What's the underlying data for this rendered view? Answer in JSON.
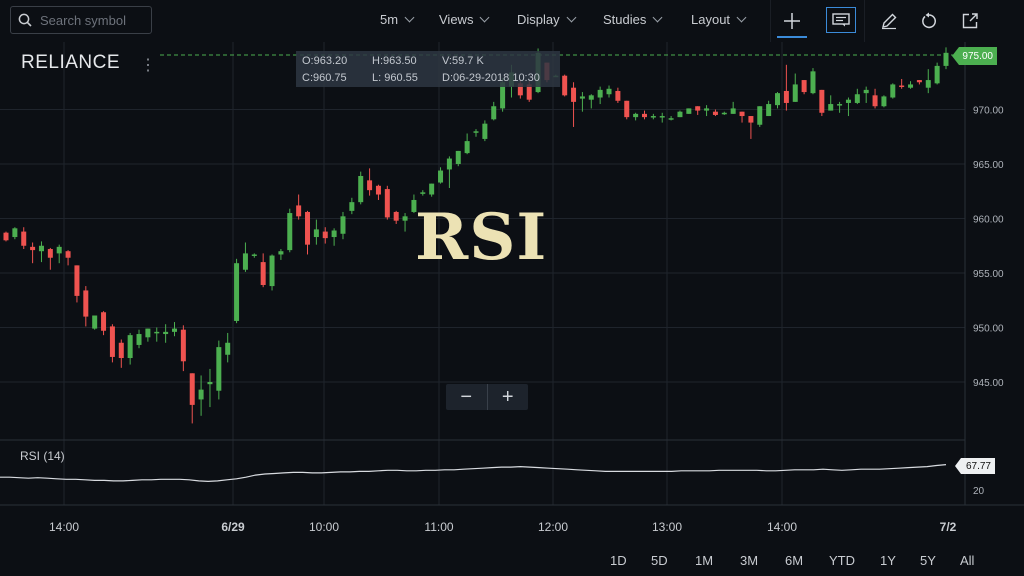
{
  "toolbar": {
    "search_placeholder": "Search symbol",
    "interval": "5m",
    "views": "Views",
    "display": "Display",
    "studies": "Studies",
    "layout": "Layout",
    "icons": [
      "search-icon",
      "crosshair-icon",
      "comment-icon",
      "pencil-icon",
      "undo-icon",
      "share-icon"
    ]
  },
  "symbol": "RELIANCE",
  "ohlc": {
    "open": "O:963.20",
    "high": "H:963.50",
    "volume": "V:59.7 K",
    "close": "C:960.75",
    "low": "L: 960.55",
    "date": "D:06-29-2018 10:30"
  },
  "overlay_text": "RSI",
  "zoom": {
    "minus": "−",
    "plus": "+"
  },
  "rsi": {
    "label": "RSI (14)",
    "value": "67.77",
    "tick": "20"
  },
  "range_buttons": [
    "1D",
    "5D",
    "1M",
    "3M",
    "6M",
    "YTD",
    "1Y",
    "5Y",
    "All"
  ],
  "colors": {
    "up": "#4caf50",
    "down": "#ef5350",
    "background": "#0c0f14",
    "grid": "#1f242c",
    "accent": "#3b8bd9"
  },
  "chart_data": {
    "type": "candlestick",
    "ylim": [
      940,
      976
    ],
    "price_ticks": [
      "975.00",
      "970.00",
      "965.00",
      "960.00",
      "955.00",
      "950.00",
      "945.00"
    ],
    "price_tick_values": [
      975,
      970,
      965,
      960,
      955,
      950,
      945
    ],
    "last_price": "975.00",
    "time_ticks": [
      {
        "label": "14:00",
        "bold": false
      },
      {
        "label": "6/29",
        "bold": true
      },
      {
        "label": "10:00",
        "bold": false
      },
      {
        "label": "11:00",
        "bold": false
      },
      {
        "label": "12:00",
        "bold": false
      },
      {
        "label": "13:00",
        "bold": false
      },
      {
        "label": "14:00",
        "bold": false
      },
      {
        "label": "7/2",
        "bold": true
      }
    ],
    "candles": [
      [
        958.7,
        958.8,
        957.9,
        958.0
      ],
      [
        958.3,
        959.2,
        958.1,
        959.1
      ],
      [
        958.8,
        959.2,
        957.2,
        957.5
      ],
      [
        957.4,
        957.8,
        955.9,
        957.1
      ],
      [
        957.0,
        957.9,
        956.0,
        957.5
      ],
      [
        957.2,
        957.3,
        955.3,
        956.4
      ],
      [
        956.8,
        957.6,
        955.9,
        957.4
      ],
      [
        957.0,
        957.1,
        955.7,
        956.4
      ],
      [
        955.7,
        955.7,
        952.3,
        952.9
      ],
      [
        953.4,
        953.8,
        950.1,
        951.0
      ],
      [
        949.9,
        951.1,
        949.8,
        951.1
      ],
      [
        951.4,
        951.5,
        949.3,
        949.7
      ],
      [
        950.1,
        950.3,
        946.8,
        947.3
      ],
      [
        948.6,
        948.9,
        946.3,
        947.2
      ],
      [
        947.2,
        949.5,
        946.6,
        949.3
      ],
      [
        948.4,
        949.8,
        948.1,
        949.4
      ],
      [
        949.1,
        949.9,
        948.7,
        949.9
      ],
      [
        949.5,
        950.0,
        948.7,
        949.6
      ],
      [
        949.4,
        950.3,
        948.6,
        949.6
      ],
      [
        949.6,
        950.5,
        949.2,
        949.9
      ],
      [
        949.8,
        950.2,
        946.0,
        946.9
      ],
      [
        945.8,
        945.8,
        941.2,
        942.9
      ],
      [
        943.4,
        945.6,
        941.9,
        944.3
      ],
      [
        944.8,
        946.2,
        942.7,
        945.0
      ],
      [
        944.2,
        948.8,
        943.4,
        948.2
      ],
      [
        947.5,
        949.5,
        946.8,
        948.6
      ],
      [
        950.6,
        956.3,
        950.4,
        955.9
      ],
      [
        955.3,
        957.8,
        955.1,
        956.8
      ],
      [
        956.6,
        956.8,
        956.4,
        956.7
      ],
      [
        956.0,
        956.8,
        953.7,
        953.9
      ],
      [
        953.8,
        956.7,
        953.4,
        956.6
      ],
      [
        956.7,
        957.2,
        956.2,
        957.0
      ],
      [
        957.1,
        960.9,
        956.9,
        960.5
      ],
      [
        961.2,
        962.2,
        959.9,
        960.2
      ],
      [
        960.6,
        960.7,
        956.7,
        957.6
      ],
      [
        958.3,
        959.9,
        957.6,
        959.0
      ],
      [
        958.8,
        959.2,
        957.7,
        958.2
      ],
      [
        958.3,
        959.1,
        957.5,
        958.9
      ],
      [
        958.6,
        960.6,
        958.1,
        960.2
      ],
      [
        960.7,
        961.9,
        960.4,
        961.5
      ],
      [
        961.5,
        964.3,
        961.3,
        963.9
      ],
      [
        963.5,
        964.6,
        962.1,
        962.6
      ],
      [
        963.0,
        963.1,
        961.7,
        962.2
      ],
      [
        962.7,
        963.0,
        959.9,
        960.1
      ],
      [
        960.6,
        960.7,
        959.5,
        959.8
      ],
      [
        959.8,
        960.5,
        958.8,
        960.2
      ],
      [
        960.6,
        962.2,
        960.5,
        961.7
      ],
      [
        962.3,
        962.6,
        962.1,
        962.4
      ],
      [
        962.2,
        963.2,
        962.0,
        963.2
      ],
      [
        963.3,
        964.7,
        963.2,
        964.4
      ],
      [
        964.5,
        965.7,
        962.8,
        965.5
      ],
      [
        965.0,
        966.2,
        964.8,
        966.2
      ],
      [
        966.0,
        967.8,
        965.9,
        967.1
      ],
      [
        967.9,
        968.2,
        967.5,
        968.0
      ],
      [
        967.3,
        969.0,
        967.1,
        968.7
      ],
      [
        969.1,
        970.7,
        969.0,
        970.3
      ],
      [
        970.1,
        972.9,
        969.8,
        972.5
      ],
      [
        972.1,
        974.1,
        971.1,
        973.4
      ],
      [
        972.4,
        972.7,
        971.0,
        971.3
      ],
      [
        972.3,
        972.6,
        970.7,
        970.9
      ],
      [
        971.6,
        975.6,
        971.5,
        975.2
      ],
      [
        974.3,
        974.3,
        972.5,
        972.7
      ],
      [
        973.0,
        973.2,
        973.0,
        973.1
      ],
      [
        973.1,
        973.2,
        971.2,
        971.3
      ],
      [
        972.0,
        972.5,
        968.4,
        970.7
      ],
      [
        971.0,
        971.6,
        969.8,
        971.2
      ],
      [
        970.9,
        971.4,
        970.1,
        971.3
      ],
      [
        971.1,
        972.1,
        970.5,
        971.8
      ],
      [
        971.4,
        972.2,
        971.1,
        971.9
      ],
      [
        971.7,
        972.0,
        970.6,
        970.8
      ],
      [
        970.8,
        970.8,
        969.1,
        969.3
      ],
      [
        969.3,
        969.7,
        969.0,
        969.6
      ],
      [
        969.6,
        969.9,
        969.1,
        969.3
      ],
      [
        969.3,
        969.6,
        969.1,
        969.4
      ],
      [
        969.4,
        969.7,
        968.8,
        969.4
      ],
      [
        969.2,
        969.4,
        969.0,
        969.2
      ],
      [
        969.3,
        969.9,
        969.3,
        969.8
      ],
      [
        969.6,
        970.1,
        969.6,
        970.1
      ],
      [
        970.3,
        970.3,
        969.5,
        969.9
      ],
      [
        969.9,
        970.4,
        969.4,
        970.1
      ],
      [
        969.8,
        970.0,
        969.4,
        969.5
      ],
      [
        969.6,
        969.8,
        969.5,
        969.7
      ],
      [
        969.6,
        970.7,
        969.6,
        970.1
      ],
      [
        969.8,
        969.8,
        968.8,
        969.4
      ],
      [
        969.4,
        969.4,
        967.3,
        968.8
      ],
      [
        968.6,
        970.3,
        968.4,
        970.3
      ],
      [
        969.4,
        970.8,
        969.4,
        970.5
      ],
      [
        970.4,
        971.6,
        970.1,
        971.5
      ],
      [
        971.7,
        974.1,
        969.9,
        970.6
      ],
      [
        970.7,
        973.3,
        970.7,
        972.3
      ],
      [
        972.7,
        972.7,
        971.4,
        971.6
      ],
      [
        971.5,
        973.8,
        971.4,
        973.5
      ],
      [
        971.8,
        971.8,
        969.4,
        969.7
      ],
      [
        969.9,
        971.3,
        969.9,
        970.5
      ],
      [
        970.4,
        970.7,
        969.7,
        970.5
      ],
      [
        970.6,
        971.1,
        969.4,
        970.9
      ],
      [
        970.6,
        971.9,
        970.5,
        971.4
      ],
      [
        971.5,
        972.1,
        970.6,
        971.8
      ],
      [
        971.3,
        971.9,
        970.1,
        970.3
      ],
      [
        970.3,
        971.3,
        970.2,
        971.2
      ],
      [
        971.1,
        972.4,
        971.0,
        972.3
      ],
      [
        972.2,
        972.8,
        971.9,
        972.1
      ],
      [
        972.0,
        972.6,
        971.9,
        972.3
      ],
      [
        972.7,
        972.7,
        972.3,
        972.5
      ],
      [
        972.0,
        973.7,
        971.5,
        972.7
      ],
      [
        972.4,
        974.3,
        972.3,
        974.0
      ],
      [
        974.0,
        975.7,
        973.7,
        975.2
      ]
    ],
    "rsi_series": [
      44,
      44,
      43,
      42,
      43,
      42,
      41,
      40,
      40,
      39,
      38,
      38,
      37,
      37,
      38,
      39,
      39,
      40,
      40,
      40,
      39,
      37,
      36,
      37,
      39,
      41,
      44,
      48,
      50,
      51,
      52,
      53,
      53,
      52,
      52,
      53,
      54,
      54,
      55,
      55,
      56,
      57,
      57,
      56,
      56,
      57,
      57,
      58,
      58,
      59,
      60,
      61,
      62,
      63,
      63,
      64,
      63,
      62,
      61,
      60,
      59,
      58,
      57,
      56,
      55,
      55,
      55,
      55,
      55,
      55,
      55,
      55,
      56,
      56,
      56,
      56,
      57,
      57,
      57,
      57,
      57,
      56,
      56,
      57,
      58,
      58,
      58,
      59,
      58,
      57,
      58,
      59,
      59,
      59,
      60,
      61,
      62,
      63,
      64,
      66,
      67.77
    ]
  }
}
